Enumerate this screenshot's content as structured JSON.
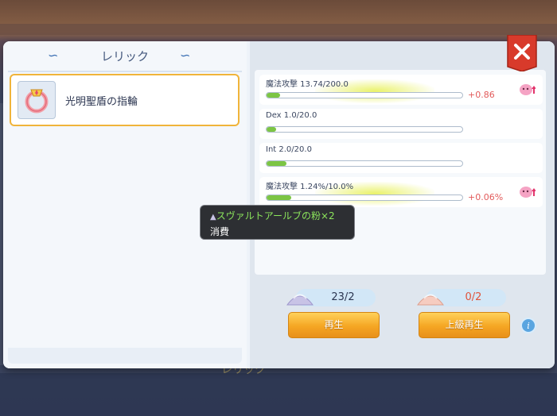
{
  "window": {
    "title": "レリック"
  },
  "relic_list": {
    "items": [
      {
        "name": "光明聖盾の指輪",
        "icon": "ring-icon",
        "selected": true
      }
    ]
  },
  "stats": [
    {
      "label": "魔法攻撃  13.74/200.0",
      "progress": 0.069,
      "delta": "+0.86",
      "upgrade": true
    },
    {
      "label": "Dex  1.0/20.0",
      "progress": 0.05,
      "delta": "",
      "upgrade": false
    },
    {
      "label": "Int  2.0/20.0",
      "progress": 0.1,
      "delta": "",
      "upgrade": false
    },
    {
      "label": "魔法攻撃  1.24%/10.0%",
      "progress": 0.124,
      "delta": "+0.06%",
      "upgrade": true
    }
  ],
  "currencies": [
    {
      "icon": "blue-powder-icon",
      "value": "23/2",
      "color": "#2b3550"
    },
    {
      "icon": "pink-powder-icon",
      "value": "0/2",
      "color": "#e0533b"
    }
  ],
  "buttons": {
    "regen": "再生",
    "advanced_regen": "上級再生"
  },
  "tooltip": {
    "item": "スヴァルトアールブの粉×2",
    "action": "消費"
  },
  "background_label": "レリック",
  "colors": {
    "accent": "#f5a623",
    "close": "#d83a2b",
    "bar_fill": "#7cc544"
  }
}
